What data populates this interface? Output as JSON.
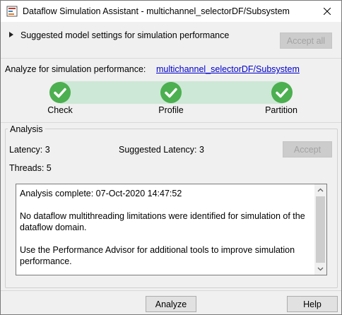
{
  "window": {
    "title": "Dataflow Simulation Assistant - multichannel_selectorDF/Subsystem"
  },
  "settings": {
    "label": "Suggested model settings for simulation performance",
    "accept_all_label": "Accept all"
  },
  "analyze": {
    "label": "Analyze for simulation performance:",
    "link": "multichannel_selectorDF/Subsystem"
  },
  "steps": [
    {
      "label": "Check",
      "status": "complete"
    },
    {
      "label": "Profile",
      "status": "complete"
    },
    {
      "label": "Partition",
      "status": "complete"
    }
  ],
  "analysis": {
    "group_title": "Analysis",
    "latency": "Latency: 3",
    "suggested_latency": "Suggested Latency: 3",
    "threads": "Threads: 5",
    "accept_label": "Accept",
    "messages": [
      "Analysis complete: 07-Oct-2020 14:47:52",
      "No dataflow multithreading limitations were identified for simulation of the dataflow domain.",
      "Use the Performance Advisor for additional tools to improve simulation performance."
    ]
  },
  "footer": {
    "analyze_label": "Analyze",
    "help_label": "Help"
  },
  "colors": {
    "step_green": "#4caf50",
    "progress_band": "#cde8d6",
    "link": "#0000cc"
  }
}
